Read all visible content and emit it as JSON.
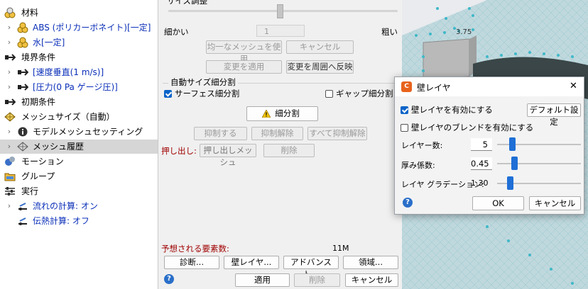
{
  "tree": {
    "materials": "材料",
    "abs": "ABS (ポリカーボネイト)[一定]",
    "water": "水[一定]",
    "boundary": "境界条件",
    "velocity": "[速度垂直(1 m/s)]",
    "pressure": "[圧力(0 Pa ゲージ圧)]",
    "initial": "初期条件",
    "meshsize": "メッシュサイズ（自動）",
    "model_mesh": "モデルメッシュセッティング",
    "mesh_history": "メッシュ履歴",
    "motion": "モーション",
    "group": "グループ",
    "run": "実行",
    "flow_calc": "流れの計算: オン",
    "heat_calc": "伝熱計算: オフ"
  },
  "mid": {
    "size_adjust": "サイズ調整",
    "fine": "細かい",
    "coarse": "粗い",
    "slider_value": "1",
    "uniform_mesh": "均一なメッシュを使用",
    "cancel": "キャンセル",
    "apply_change": "変更を適用",
    "reflect_change": "変更を周囲へ反映",
    "auto_refine": "自動サイズ細分割",
    "surface_refine": "サーフェス細分割",
    "gap_refine": "ギャップ細分割",
    "refine_btn": "細分割",
    "suppress": "抑制する",
    "unsuppress": "抑制解除",
    "unsuppress_all": "すべて抑制解除",
    "extrude_label": "押し出し:",
    "extrude_mesh": "押し出しメッシュ",
    "delete": "削除",
    "expected_label": "予想される要素数:",
    "expected_value": "11M",
    "diagnose": "診断...",
    "wall_layer": "壁レイヤ...",
    "advanced": "アドバンスト...",
    "region": "領域...",
    "apply": "適用",
    "delete2": "削除",
    "cancel2": "キャンセル",
    "help": "?"
  },
  "viewport": {
    "dimension": "3.75"
  },
  "dialog": {
    "title": "壁レイヤ",
    "close": "✕",
    "enable_wall": "壁レイヤを有効にする",
    "default_settings": "デフォルト設定",
    "enable_blend": "壁レイヤのブレンドを有効にする",
    "layers_label": "レイヤー数:",
    "layers_value": "5",
    "layers_fraction": 0.14,
    "thickness_label": "厚み係数:",
    "thickness_value": "0.45",
    "thickness_fraction": 0.17,
    "gradation_label": "レイヤ グラデーション:",
    "gradation_value": "1.30",
    "gradation_fraction": 0.12,
    "ok": "OK",
    "cancel": "キャンセル",
    "help": "?"
  },
  "colors": {
    "accent": "#0a64c8",
    "link_blue": "#0a2fb8",
    "warn_red": "#a00000",
    "mesh_cyan": "#3fb8c8"
  }
}
